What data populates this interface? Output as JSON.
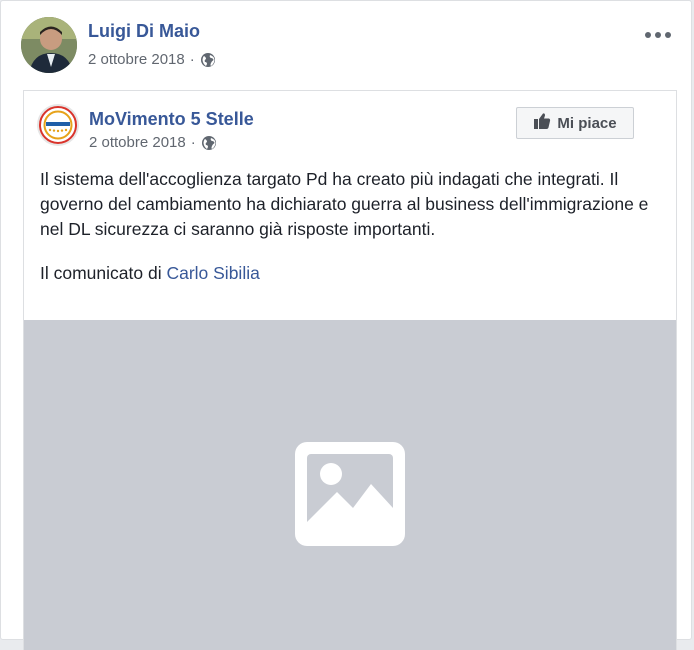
{
  "post": {
    "author": "Luigi Di Maio",
    "date": "2 ottobre 2018",
    "separator": "·"
  },
  "shared": {
    "page_name": "MoVimento 5 Stelle",
    "date": "2 ottobre 2018",
    "separator": "·",
    "like_label": "Mi piace",
    "text_p1": "Il sistema dell'accoglienza targato Pd ha creato più indagati che integrati. Il governo del cambiamento ha dichiarato guerra al business dell'immigrazione e nel DL sicurezza ci saranno già risposte importanti.",
    "text_p2_prefix": "Il comunicato di ",
    "text_p2_link": "Carlo Sibilia"
  },
  "icons": {
    "more": "more-options-icon",
    "globe": "globe-icon",
    "thumb": "thumbs-up-icon",
    "image_placeholder": "image-placeholder-icon"
  },
  "colors": {
    "link_blue": "#385898",
    "placeholder_bg": "#c9ccd3",
    "meta_gray": "#616770"
  }
}
